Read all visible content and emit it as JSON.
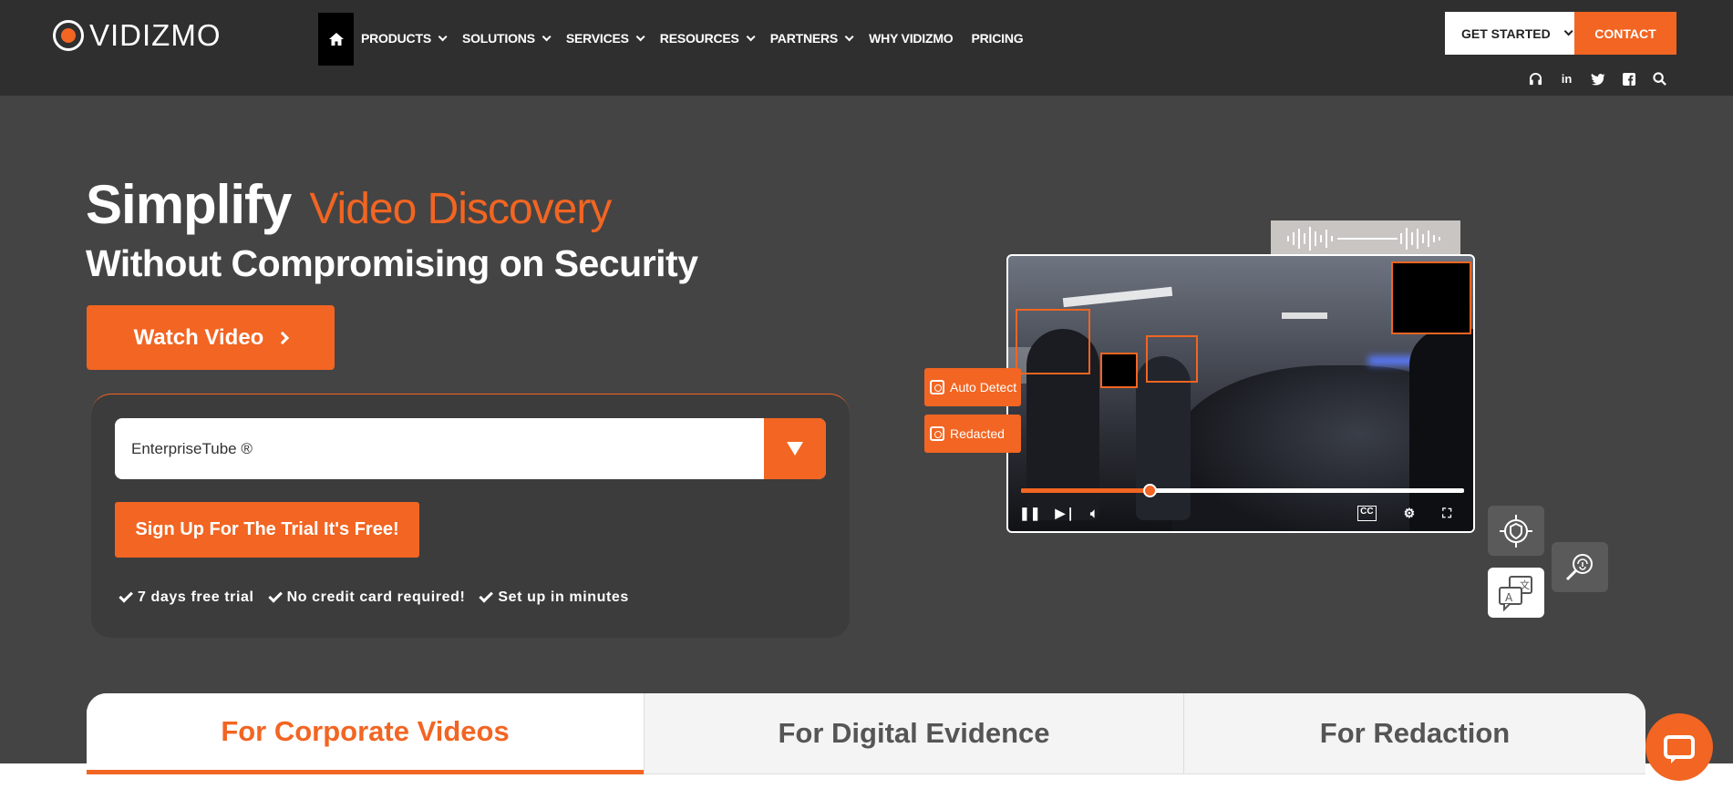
{
  "header": {
    "logo_text": "VIDIZMO",
    "nav": [
      {
        "label": "PRODUCTS",
        "dropdown": true
      },
      {
        "label": "SOLUTIONS",
        "dropdown": true
      },
      {
        "label": "SERVICES",
        "dropdown": true
      },
      {
        "label": "RESOURCES",
        "dropdown": true
      },
      {
        "label": "PARTNERS",
        "dropdown": true
      },
      {
        "label": "WHY VIDIZMO",
        "dropdown": false
      },
      {
        "label": "PRICING",
        "dropdown": false
      }
    ],
    "get_started_label": "GET STARTED",
    "contact_label": "CONTACT",
    "social_icons": [
      "headset-icon",
      "linkedin-icon",
      "twitter-icon",
      "facebook-icon",
      "search-icon"
    ]
  },
  "hero": {
    "title_main": "Simplify",
    "title_accent": "Video Discovery",
    "subtitle": "Without Compromising on Security",
    "watch_label": "Watch Video",
    "product_select_value": "EnterpriseTube ®",
    "signup_label": "Sign Up For The Trial It's Free!",
    "perks": [
      "7 days free trial",
      "No credit card required!",
      "Set up in minutes"
    ]
  },
  "player": {
    "tags": [
      "Auto Detect",
      "Redacted"
    ],
    "progress": 0.29
  },
  "tabs": [
    "For Corporate Videos",
    "For Digital Evidence",
    "For Redaction"
  ],
  "colors": {
    "accent": "#f26522",
    "header_bg": "#2f2f2f",
    "page_bg": "#444444"
  }
}
